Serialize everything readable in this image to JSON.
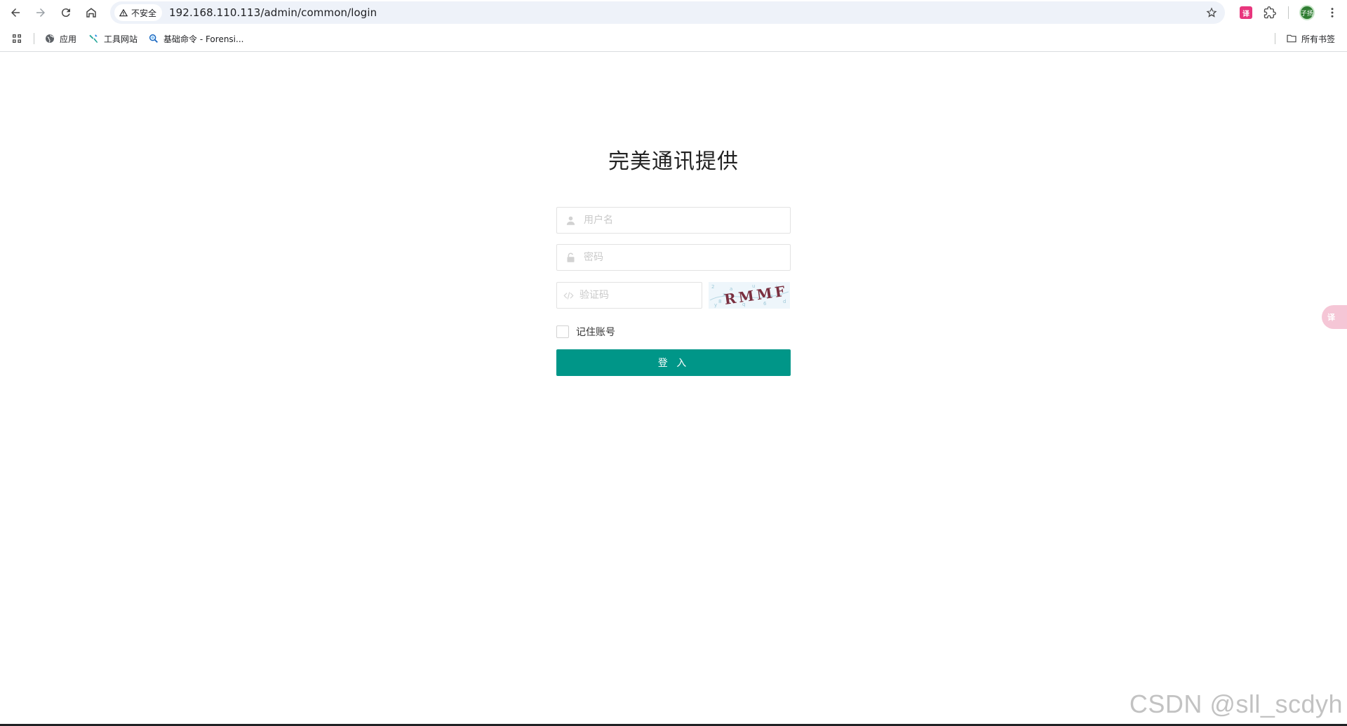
{
  "browser": {
    "security_label": "不安全",
    "url": "192.168.110.113/admin/common/login",
    "extension_label": "译",
    "profile_label": "子扬"
  },
  "bookmarks": {
    "items": [
      {
        "label": "应用"
      },
      {
        "label": "工具网站"
      },
      {
        "label": "基础命令 - Forensi..."
      }
    ],
    "all_bookmarks_label": "所有书签"
  },
  "login": {
    "title": "完美通讯提供",
    "username_placeholder": "用户名",
    "password_placeholder": "密码",
    "captcha_placeholder": "验证码",
    "captcha_text": "RMMF",
    "remember_label": "记住账号",
    "submit_label": "登 入"
  },
  "floating_widget_label": "译",
  "watermark": "CSDN @sll_scdyh",
  "colors": {
    "primary": "#009688",
    "omnibox_bg": "#eef2f9",
    "input_border": "#e2e2e2"
  }
}
